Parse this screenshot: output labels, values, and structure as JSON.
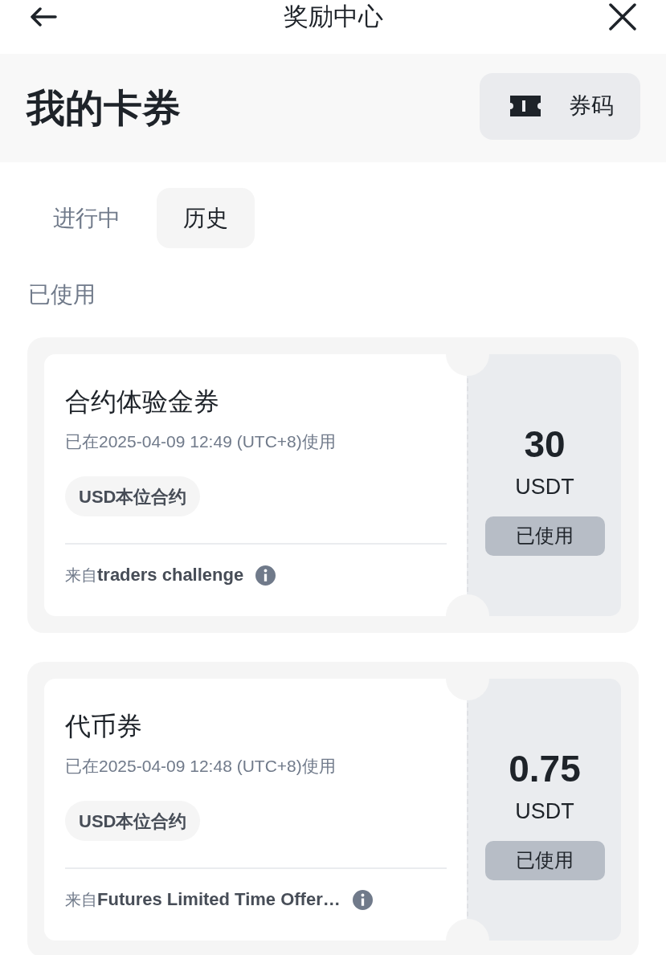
{
  "header": {
    "title": "奖励中心"
  },
  "banner": {
    "title": "我的卡券",
    "code_button": "券码"
  },
  "tabs": [
    {
      "label": "进行中",
      "selected": false
    },
    {
      "label": "历史",
      "selected": true
    }
  ],
  "section": {
    "title": "已使用"
  },
  "vouchers": [
    {
      "title": "合约体验金券",
      "used_at": "已在2025-04-09 12:49 (UTC+8)使用",
      "tag": "USD本位合约",
      "source": "来自**traders challenge**",
      "amount": "30",
      "unit": "USDT",
      "status": {
        "label": "已使用",
        "disabled": true
      }
    },
    {
      "title": "代币券",
      "used_at": "已在2025-04-09 12:48 (UTC+8)使用",
      "tag": "USD本位合约",
      "source": "来自**Futures Limited Time Offer…**",
      "amount": "0.75",
      "unit": "USDT",
      "status": {
        "label": "已使用",
        "disabled": true
      }
    }
  ]
}
